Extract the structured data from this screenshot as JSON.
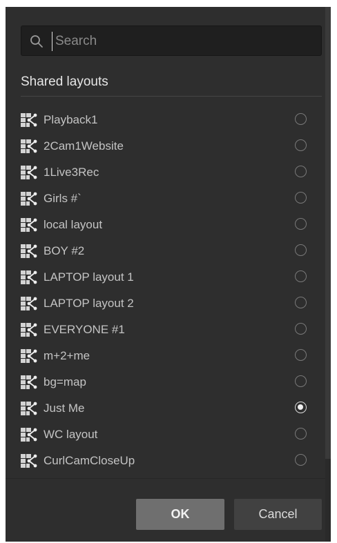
{
  "search": {
    "value": "",
    "placeholder": "Search",
    "icon": "search-icon"
  },
  "section": {
    "title": "Shared layouts"
  },
  "layouts": [
    {
      "label": "Playback1",
      "icon": "shared-layout-icon",
      "selected": false
    },
    {
      "label": "2Cam1Website",
      "icon": "shared-layout-icon",
      "selected": false
    },
    {
      "label": "1Live3Rec",
      "icon": "shared-layout-icon",
      "selected": false
    },
    {
      "label": "Girls #`",
      "icon": "shared-layout-icon",
      "selected": false
    },
    {
      "label": "local layout",
      "icon": "shared-layout-icon",
      "selected": false
    },
    {
      "label": "BOY #2",
      "icon": "shared-layout-icon",
      "selected": false
    },
    {
      "label": "LAPTOP layout 1",
      "icon": "shared-layout-icon",
      "selected": false
    },
    {
      "label": "LAPTOP layout 2",
      "icon": "shared-layout-icon",
      "selected": false
    },
    {
      "label": "EVERYONE #1",
      "icon": "shared-layout-icon",
      "selected": false
    },
    {
      "label": "m+2+me",
      "icon": "shared-layout-icon",
      "selected": false
    },
    {
      "label": "bg=map",
      "icon": "shared-layout-icon",
      "selected": false
    },
    {
      "label": "Just Me",
      "icon": "shared-layout-icon",
      "selected": true
    },
    {
      "label": "WC layout",
      "icon": "shared-layout-icon",
      "selected": false
    },
    {
      "label": "CurlCamCloseUp",
      "icon": "shared-layout-icon",
      "selected": false
    }
  ],
  "buttons": {
    "ok_label": "OK",
    "cancel_label": "Cancel"
  },
  "colors": {
    "dialog_background": "#2e2e2e",
    "ok_button": "#6f6f6f",
    "cancel_button": "#414141"
  }
}
